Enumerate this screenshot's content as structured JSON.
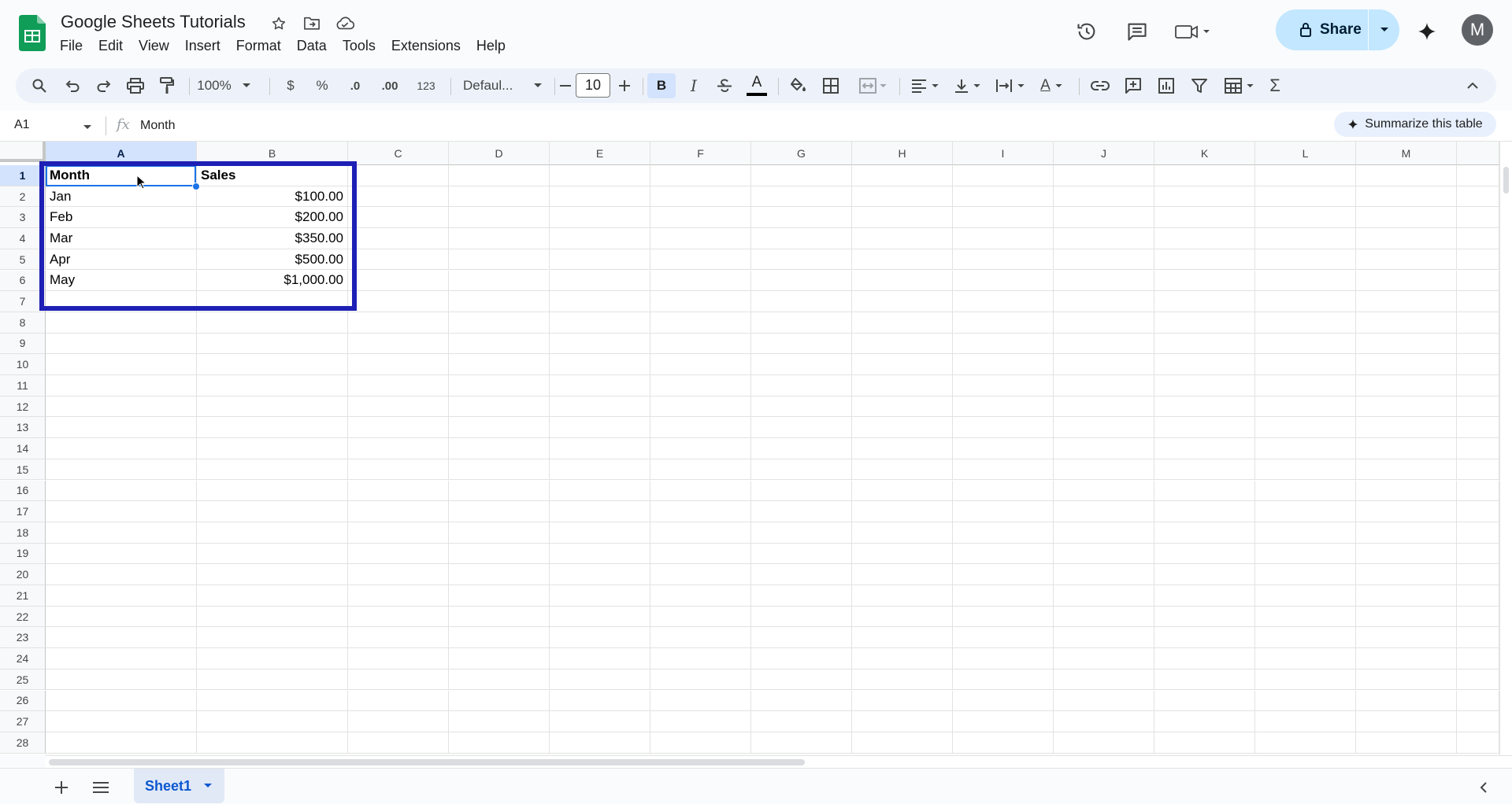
{
  "app": {
    "title": "Google Sheets Tutorials",
    "avatar_letter": "M",
    "share_label": "Share"
  },
  "menu": [
    "File",
    "Edit",
    "View",
    "Insert",
    "Format",
    "Data",
    "Tools",
    "Extensions",
    "Help"
  ],
  "toolbar": {
    "zoom": "100%",
    "currency": "$",
    "percent": "%",
    "decrease_decimal": ".0",
    "increase_decimal": ".00",
    "number_format": "123",
    "font": "Defaul...",
    "font_size": "10",
    "bold": "B",
    "italic": "I",
    "text_color_glyph": "A",
    "text_rotation_glyph": "A",
    "sum_glyph": "Σ"
  },
  "formula_bar": {
    "cell_ref": "A1",
    "fx": "fx",
    "value": "Month",
    "summarize_label": "Summarize this table"
  },
  "grid": {
    "columns": [
      "A",
      "B",
      "C",
      "D",
      "E",
      "F",
      "G",
      "H",
      "I",
      "J",
      "K",
      "L",
      "M"
    ],
    "rows": [
      "1",
      "2",
      "3",
      "4",
      "5",
      "6",
      "7",
      "8",
      "9",
      "10",
      "11",
      "12",
      "13",
      "14",
      "15",
      "16",
      "17",
      "18",
      "19",
      "20",
      "21",
      "22",
      "23",
      "24",
      "25",
      "26",
      "27",
      "28"
    ],
    "selected_column": "A",
    "selected_row": "1",
    "data": [
      [
        "Month",
        "Sales"
      ],
      [
        "Jan",
        "$100.00"
      ],
      [
        "Feb",
        "$200.00"
      ],
      [
        "Mar",
        "$350.00"
      ],
      [
        "Apr",
        "$500.00"
      ],
      [
        "May",
        "$1,000.00"
      ]
    ]
  },
  "sheets": {
    "active": "Sheet1"
  },
  "colors": {
    "accent": "#1a73e8",
    "share_bg": "#c2e7ff",
    "highlight_box": "#1d1fb5",
    "sheets_green": "#0f9d58"
  }
}
